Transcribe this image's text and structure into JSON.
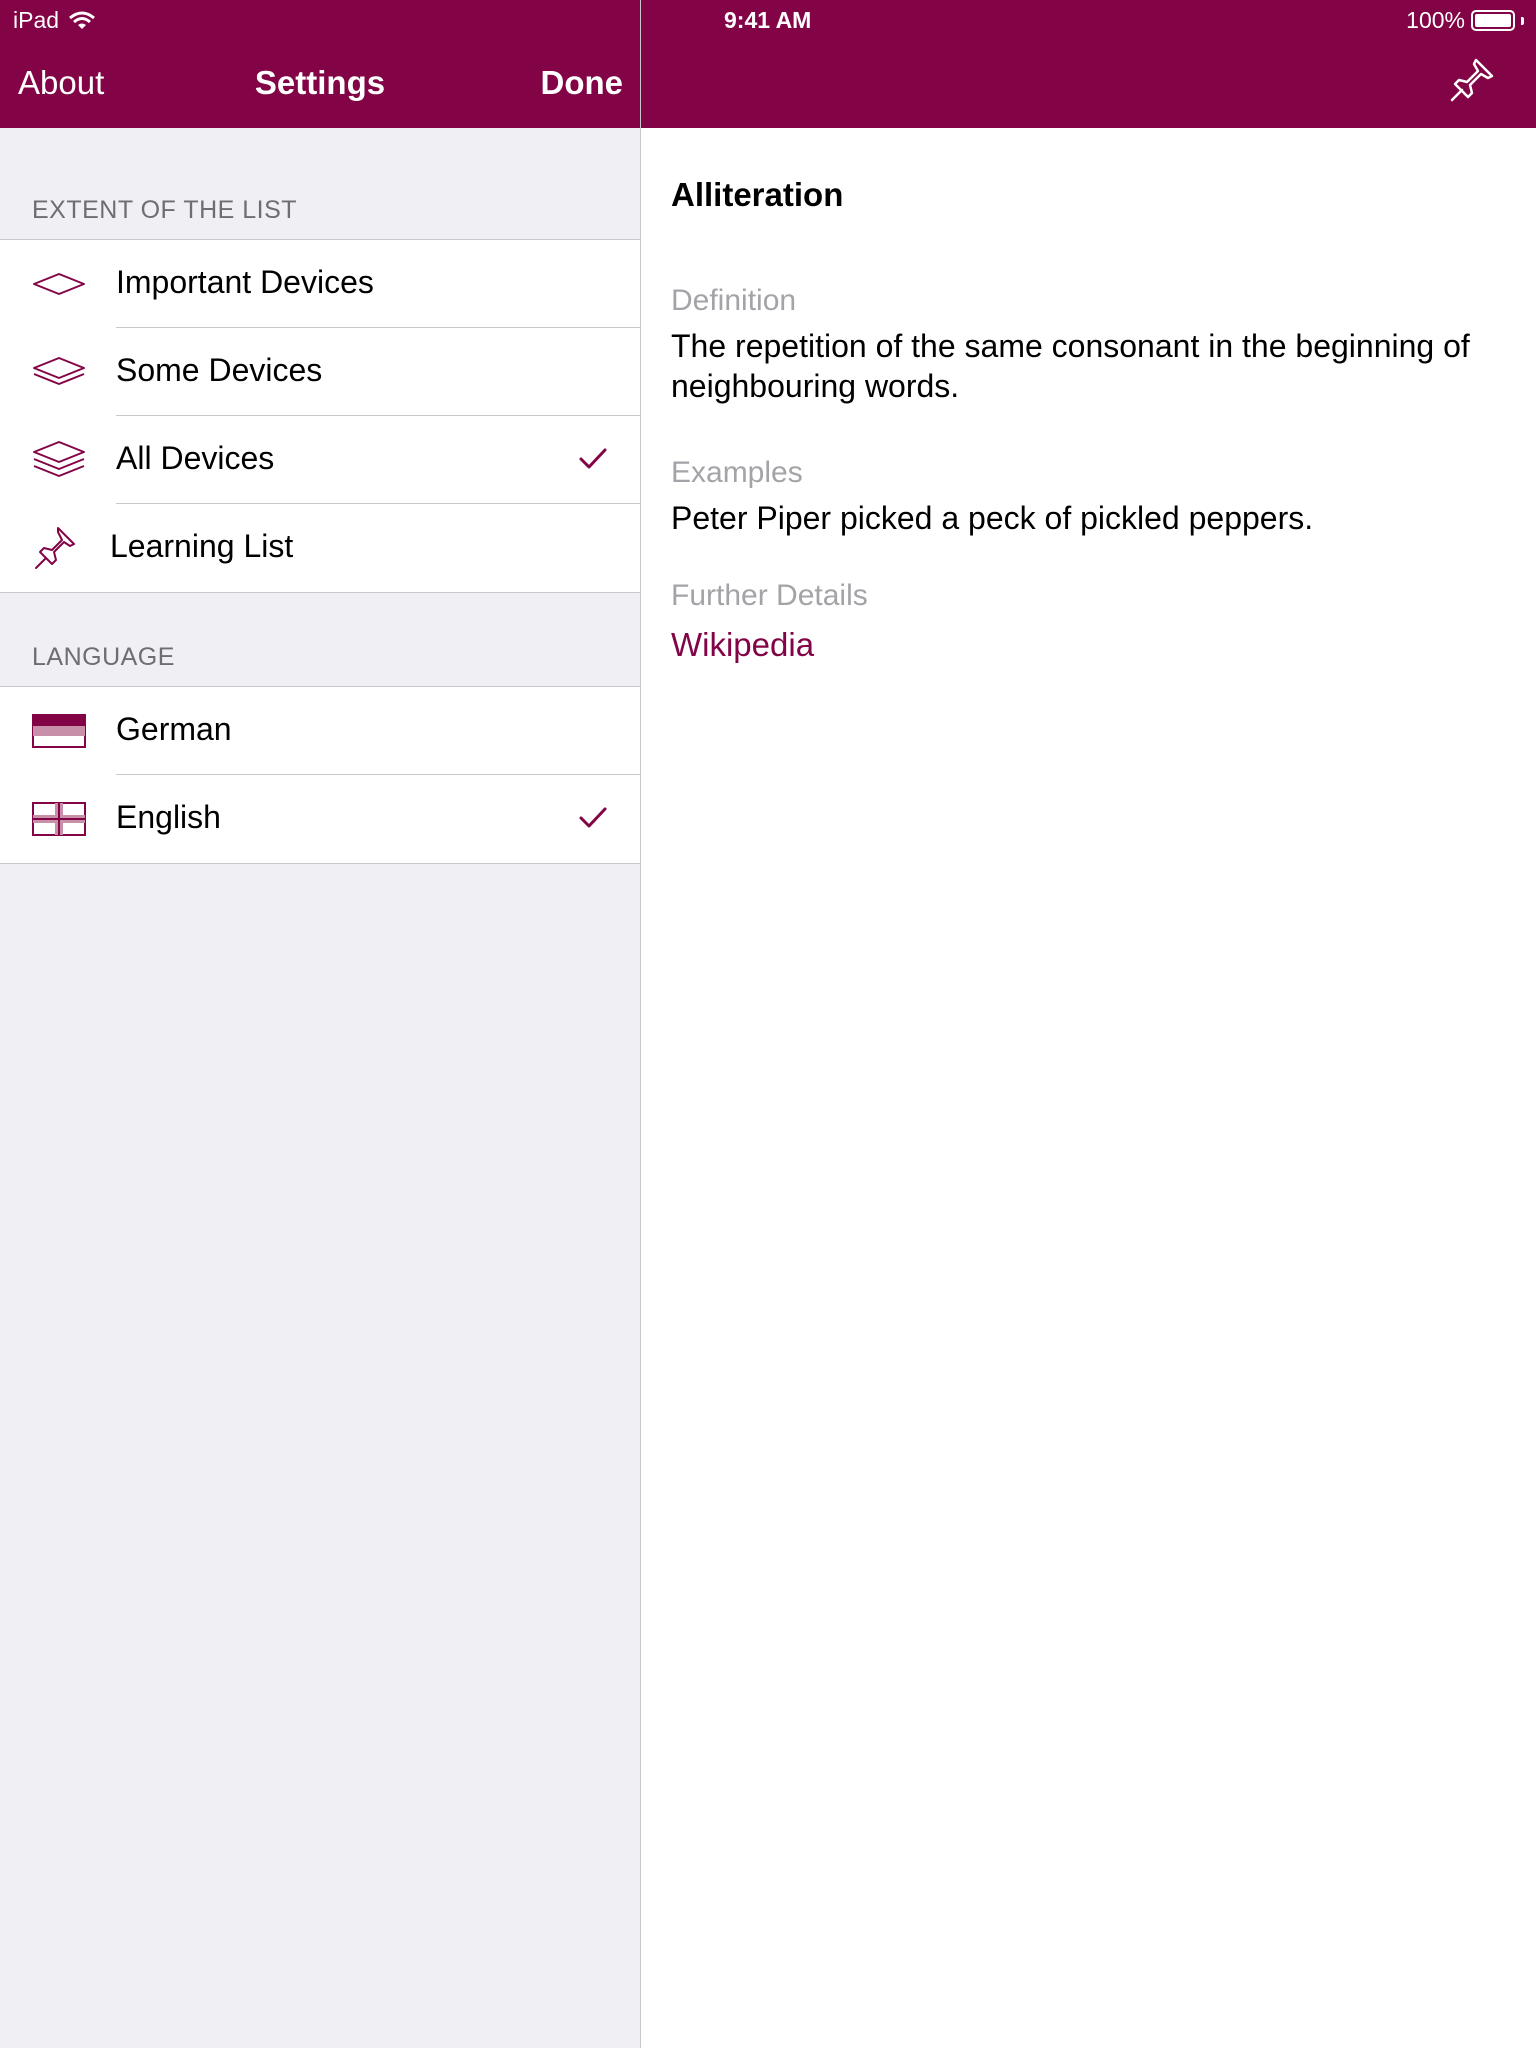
{
  "status_bar": {
    "carrier": "iPad",
    "time": "9:41 AM",
    "battery": "100%"
  },
  "nav": {
    "left_button": "About",
    "title": "Settings",
    "right_button": "Done"
  },
  "sections": [
    {
      "header": "EXTENT OF THE LIST",
      "items": [
        {
          "label": "Important Devices",
          "icon": "single-layer-icon",
          "checked": false
        },
        {
          "label": "Some Devices",
          "icon": "double-layer-icon",
          "checked": false
        },
        {
          "label": "All Devices",
          "icon": "triple-layer-icon",
          "checked": true
        },
        {
          "label": "Learning List",
          "icon": "pin-icon",
          "checked": false
        }
      ]
    },
    {
      "header": "LANGUAGE",
      "items": [
        {
          "label": "German",
          "icon": "german-flag-icon",
          "checked": false
        },
        {
          "label": "English",
          "icon": "english-flag-icon",
          "checked": true
        }
      ]
    }
  ],
  "detail": {
    "title": "Alliteration",
    "definition_label": "Definition",
    "definition_text": "The repetition of the same consonant in the beginning of neighbouring words.",
    "examples_label": "Examples",
    "examples_text": "Peter Piper picked a peck of pickled peppers.",
    "further_label": "Further Details",
    "link_text": "Wikipedia"
  },
  "colors": {
    "accent": "#830446",
    "background_grouped": "#efeff4",
    "secondary_text": "#a3a3a8"
  }
}
